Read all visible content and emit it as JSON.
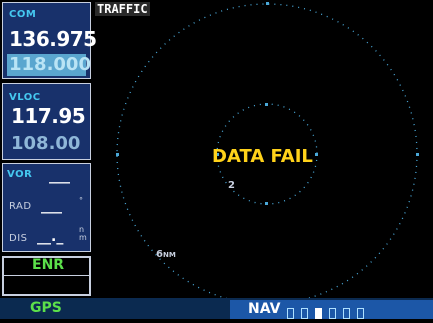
{
  "page": {
    "title": "TRAFFIC"
  },
  "com": {
    "label": "COM",
    "active": "136.975",
    "standby": "118.000"
  },
  "vloc": {
    "label": "VLOC",
    "active": "117.95",
    "standby": "108.00"
  },
  "vor": {
    "label": "VOR",
    "value": "___",
    "rad_label": "RAD",
    "rad_value": "___",
    "dis_label": "DIS",
    "dis_value": "__._",
    "dis_unit_top": "n",
    "dis_unit_bottom": "m",
    "rad_unit": "°"
  },
  "mode": {
    "label": "ENR"
  },
  "bottom": {
    "gps": "GPS",
    "nav": "NAV"
  },
  "traffic": {
    "status": "DATA FAIL",
    "inner_ring_label": "2",
    "outer_ring_label": "6",
    "outer_ring_unit": "NM"
  },
  "colors": {
    "accent": "#45c8f0",
    "status_yellow": "#ffd21a",
    "mode_green": "#5be04a",
    "panel_blue": "#18316b",
    "nav_blue": "#1c57a7"
  },
  "icons": {
    "nav_page_indicator": "page-indicator-icon",
    "range_rings": "range-rings-icon"
  }
}
